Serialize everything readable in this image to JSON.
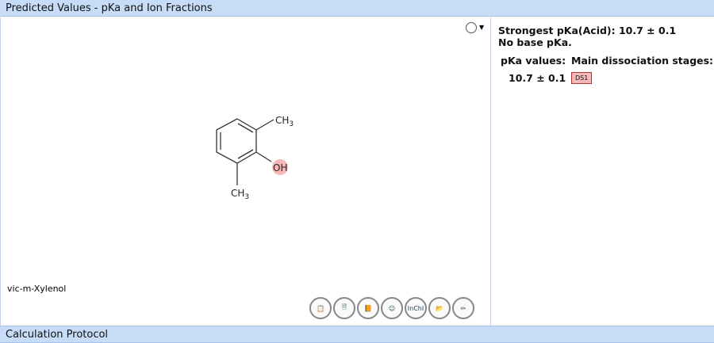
{
  "header": {
    "title": "Predicted Values - pKa and Ion Fractions"
  },
  "footer": {
    "title": "Calculation Protocol"
  },
  "molecule": {
    "name": "vic-m-Xylenol",
    "labels": {
      "ch3_top": "CH",
      "ch3_bottom": "CH",
      "sub": "3",
      "oh": "OH"
    },
    "highlight_color": "#f6b8b8"
  },
  "toolbar": [
    "copy-pdf",
    "export-pdf",
    "book",
    "smiley",
    "InChI",
    "open-folder",
    "edit-pencil"
  ],
  "toolbar_inchi_label": "InChI",
  "results": {
    "strongest": "Strongest pKa(Acid): 10.7 ± 0.1",
    "base": "No base pKa.",
    "col1": "pKa values:",
    "col2": "Main dissociation stages:",
    "value": "10.7 ± 0.1",
    "stage": "DS1"
  }
}
